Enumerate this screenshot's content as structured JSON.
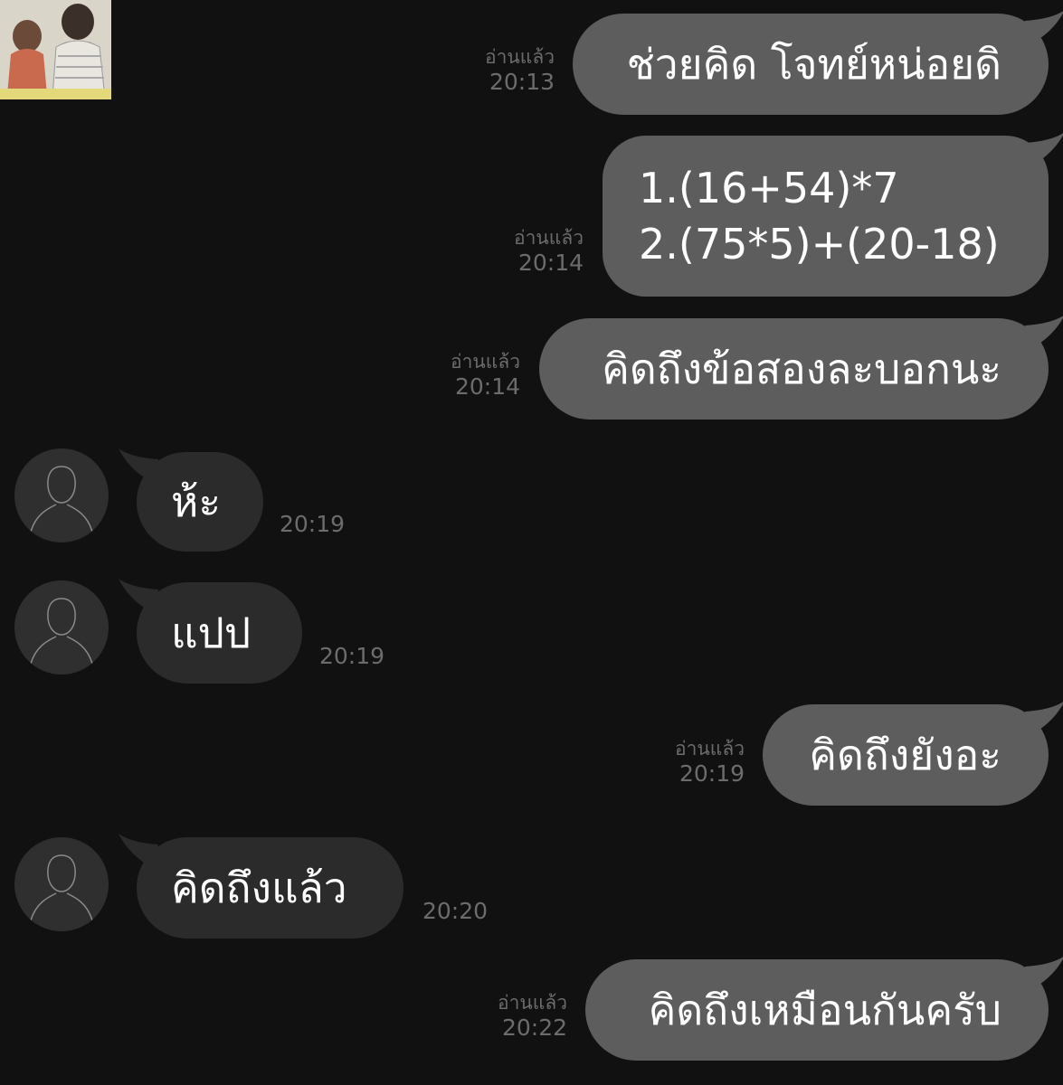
{
  "colors": {
    "background": "#111111",
    "outgoing_bubble": "#5d5d5d",
    "incoming_bubble": "#2b2b2b",
    "meta_text": "#6c6c6c"
  },
  "chat_header_thumbnail": {
    "icon": "couple-sitting-thumbnail"
  },
  "messages": [
    {
      "direction": "out",
      "text": "ช่วยคิด โจทย์หน่อยดิ",
      "read": "อ่านแล้ว",
      "time": "20:13"
    },
    {
      "direction": "out",
      "text": "1.(16+54)*7\n2.(75*5)+(20-18)",
      "read": "อ่านแล้ว",
      "time": "20:14"
    },
    {
      "direction": "out",
      "text": "คิดถึงข้อสองละบอกนะ",
      "read": "อ่านแล้ว",
      "time": "20:14"
    },
    {
      "direction": "in",
      "text": "ห้ะ",
      "time": "20:19",
      "avatar": "default-person-icon"
    },
    {
      "direction": "in",
      "text": "แปป",
      "time": "20:19",
      "avatar": "default-person-icon"
    },
    {
      "direction": "out",
      "text": "คิดถึงยังอะ",
      "read": "อ่านแล้ว",
      "time": "20:19"
    },
    {
      "direction": "in",
      "text": "คิดถึงแล้ว",
      "time": "20:20",
      "avatar": "default-person-icon"
    },
    {
      "direction": "out",
      "text": "คิดถึงเหมือนกันครับ",
      "read": "อ่านแล้ว",
      "time": "20:22"
    }
  ]
}
